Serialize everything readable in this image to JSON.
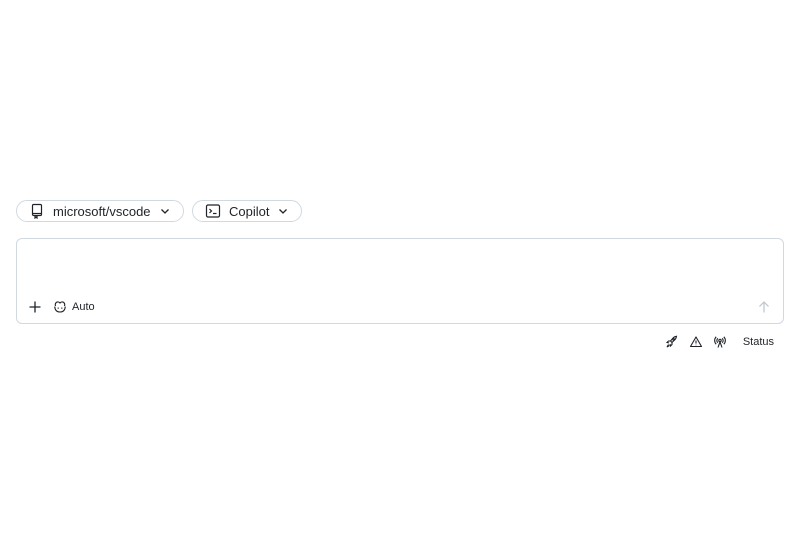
{
  "repo_picker": {
    "label": "microsoft/vscode",
    "icon": "repo-icon"
  },
  "agent_picker": {
    "label": "Copilot",
    "icon": "terminal-icon"
  },
  "composer": {
    "placeholder": "",
    "value": "",
    "model_label": "Auto",
    "model_icon": "copilot-icon",
    "add_icon": "plus-icon",
    "send_icon": "arrow-up-icon"
  },
  "status_bar": {
    "icons": [
      "rocket-icon",
      "alert-icon",
      "broadcast-icon"
    ],
    "status_label": "Status"
  },
  "colors": {
    "border": "#d1d9e0",
    "text": "#1f2328",
    "muted": "#c4c9cf"
  }
}
